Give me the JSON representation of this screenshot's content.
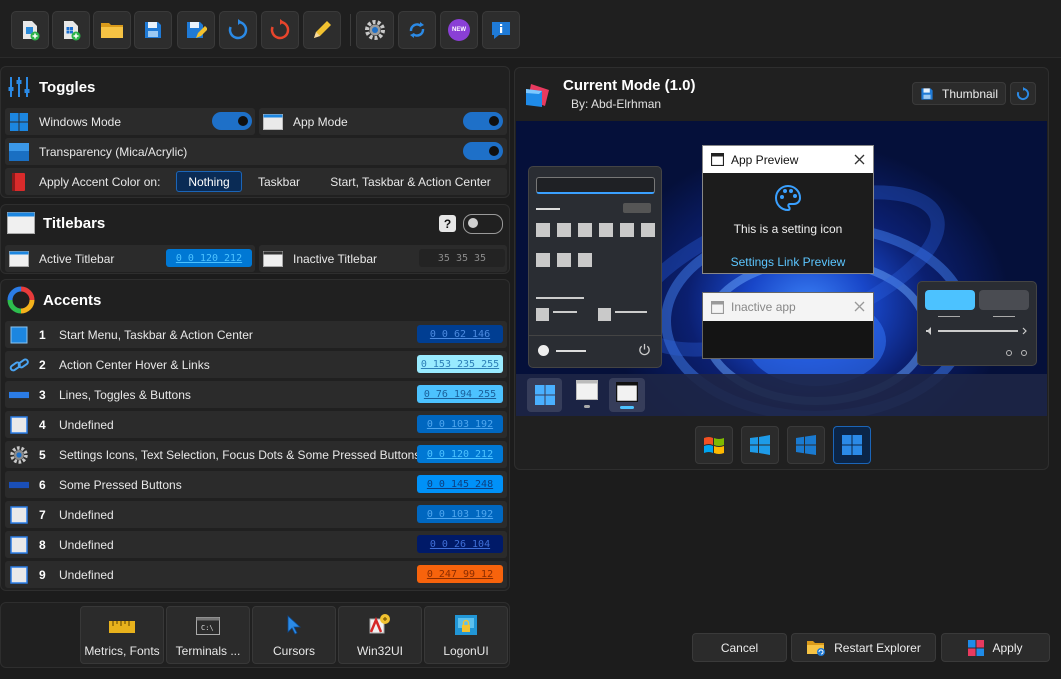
{
  "toolbar": {
    "buttons": [
      "new-theme",
      "new-from-current",
      "open",
      "save",
      "save-as",
      "refresh",
      "reset",
      "edit",
      "settings",
      "sync",
      "whats-new",
      "about"
    ],
    "new_badge": "NEW"
  },
  "toggles": {
    "title": "Toggles",
    "windows_mode": "Windows Mode",
    "app_mode": "App Mode",
    "transparency": "Transparency (Mica/Acrylic)",
    "apply_accent": "Apply Accent Color on:",
    "accent_options": [
      "Nothing",
      "Taskbar",
      "Start, Taskbar & Action Center"
    ],
    "accent_selected": "Nothing"
  },
  "titlebars": {
    "title": "Titlebars",
    "help": "?",
    "active": "Active Titlebar",
    "active_value": "0 0 120 212",
    "active_color": "#0078d4",
    "inactive": "Inactive Titlebar",
    "inactive_value": "35 35 35",
    "inactive_color": "#232323"
  },
  "accents": {
    "title": "Accents",
    "items": [
      {
        "num": "1",
        "label": "Start Menu, Taskbar & Action Center",
        "value": "0 0 62 146",
        "color": "#003e92"
      },
      {
        "num": "2",
        "label": "Action Center Hover & Links",
        "value": "0 153 235 255",
        "color": "#99ebff"
      },
      {
        "num": "3",
        "label": "Lines, Toggles & Buttons",
        "value": "0 76 194 255",
        "color": "#4cc2ff"
      },
      {
        "num": "4",
        "label": "Undefined",
        "value": "0 0 103 192",
        "color": "#0067c0"
      },
      {
        "num": "5",
        "label": "Settings Icons, Text Selection, Focus Dots & Some Pressed Buttons",
        "value": "0 0 120 212",
        "color": "#0078d4"
      },
      {
        "num": "6",
        "label": "Some Pressed Buttons",
        "value": "0 0 145 248",
        "color": "#0091f8"
      },
      {
        "num": "7",
        "label": "Undefined",
        "value": "0 0 103 192",
        "color": "#0067c0"
      },
      {
        "num": "8",
        "label": "Undefined",
        "value": "0 0 26 104",
        "color": "#001a68"
      },
      {
        "num": "9",
        "label": "Undefined",
        "value": "0 247 99 12",
        "color": "#f7630c"
      }
    ]
  },
  "tools": [
    "Metrics, Fonts",
    "Terminals ...",
    "Cursors",
    "Win32UI",
    "LogonUI"
  ],
  "preview": {
    "mode_title": "Current Mode (1.0)",
    "author": "By: Abd-Elrhman",
    "thumbnail_btn": "Thumbnail",
    "app_preview_title": "App Preview",
    "setting_text": "This is a setting icon",
    "settings_link": "Settings Link Preview",
    "inactive_app": "Inactive app"
  },
  "actions": {
    "cancel": "Cancel",
    "restart": "Restart Explorer",
    "apply": "Apply"
  },
  "colors": {
    "accent": "#0078d4",
    "toggle_on": "#1e70c8",
    "bg": "#1c1c1c",
    "panel": "#202020"
  }
}
